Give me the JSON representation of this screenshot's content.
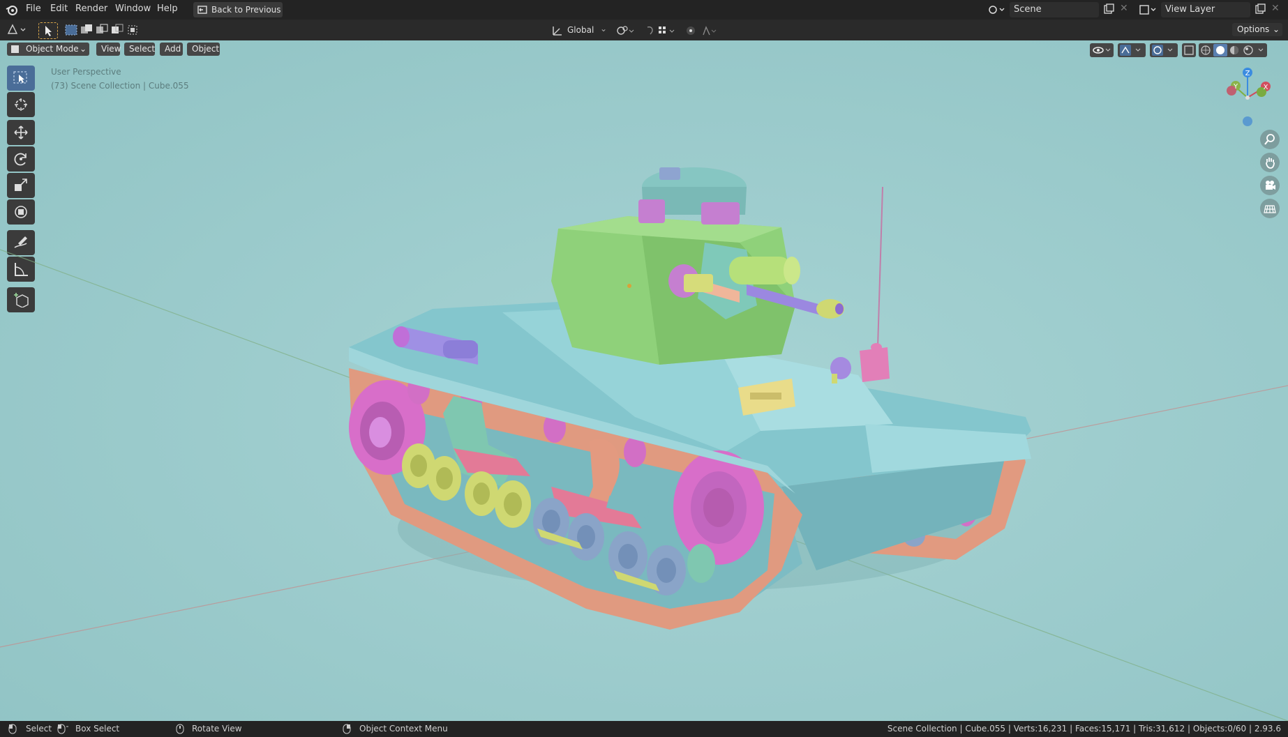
{
  "menu": {
    "file": "File",
    "edit": "Edit",
    "render": "Render",
    "window": "Window",
    "help": "Help",
    "back": "Back to Previous"
  },
  "scene": {
    "label": "Scene",
    "view_layer": "View Layer"
  },
  "toolbar": {
    "transform_orientation": "Global",
    "options": "Options"
  },
  "viewport_header": {
    "mode": "Object Mode",
    "view": "View",
    "select": "Select",
    "add": "Add",
    "object": "Object"
  },
  "viewport": {
    "perspective": "User Perspective",
    "collection": "(73) Scene Collection | Cube.055"
  },
  "gizmo": {
    "z": "Z",
    "y": "Y",
    "x": "X"
  },
  "status": {
    "select": "Select",
    "box_select": "Box Select",
    "rotate_view": "Rotate View",
    "context_menu": "Object Context Menu",
    "stats": "Scene Collection | Cube.055 | Verts:16,231 | Faces:15,171 | Tris:31,612 | Objects:0/60 | 2.93.6"
  },
  "icons": [
    "blender-logo-icon",
    "back-icon",
    "scene-icon",
    "view-layer-icon",
    "select-box-icon",
    "cursor-icon",
    "move-icon",
    "rotate-icon",
    "scale-icon",
    "transform-icon",
    "annotate-icon",
    "measure-icon",
    "add-cube-icon",
    "zoom-icon",
    "pan-hand-icon",
    "camera-icon",
    "grid-icon"
  ]
}
